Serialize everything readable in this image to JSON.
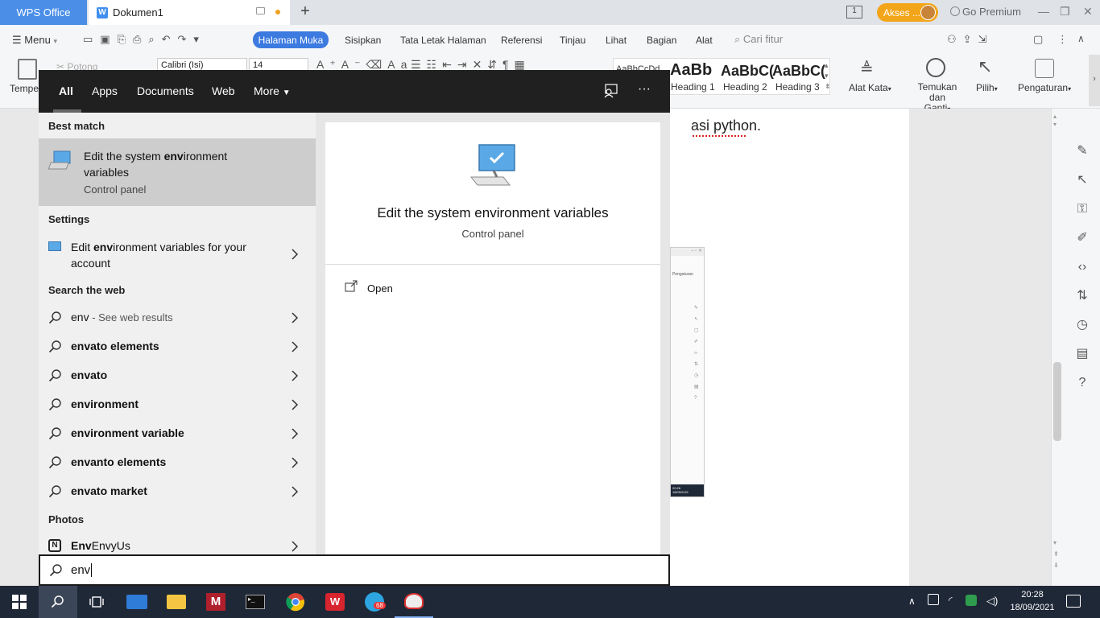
{
  "wps": {
    "app_tab": "WPS Office",
    "doc_tab": "Dokumen1",
    "doc_tab_icon": "W",
    "akses": "Akses ...",
    "go_premium": "Go Premium",
    "menu": "Menu",
    "tabs": [
      "Halaman Muka",
      "Sisipkan",
      "Tata Letak Halaman",
      "Referensi",
      "Tinjau",
      "Lihat",
      "Bagian",
      "Alat"
    ],
    "find_placeholder": "Cari fitur",
    "font_name": "Calibri (Isi)",
    "font_size": "14",
    "potong": "Potong",
    "tempel": "Tempel",
    "styles": [
      "AaBbCcDd",
      "AaBb",
      "AaBbC(",
      "AaBbC("
    ],
    "style_names": [
      "Heading 1",
      "Heading 2",
      "Heading 3"
    ],
    "alat_kata": "Alat Kata",
    "temukan": "Temukan dan",
    "ganti": "Ganti",
    "pilih": "Pilih",
    "pengaturan": "Pengaturan",
    "doc_text": "asi python.",
    "thumb_label": "Pengaturan",
    "thumb_time": "20:26",
    "thumb_date": "18/09/2021"
  },
  "search": {
    "tabs": [
      "All",
      "Apps",
      "Documents",
      "Web",
      "More"
    ],
    "best_match_header": "Best match",
    "best_match_title_prefix": "Edit the system ",
    "best_match_title_bold": "env",
    "best_match_title_line1_suffix": "ironment",
    "best_match_title_line2": "variables",
    "best_match_subtitle": "Control panel",
    "settings_header": "Settings",
    "settings_item_prefix": "Edit ",
    "settings_item_bold": "env",
    "settings_item_suffix": "ironment variables for your",
    "settings_item_line2": "account",
    "web_header": "Search the web",
    "web_first_query": "env",
    "web_first_suffix": " - See web results",
    "web_suggestions": [
      "envato elements",
      "envato",
      "environment",
      "environment variable",
      "envanto elements",
      "envato market"
    ],
    "photos_header": "Photos",
    "photos_item": "EnvyUs",
    "detail_title": "Edit the system environment variables",
    "detail_subtitle": "Control panel",
    "detail_action": "Open",
    "query": "env"
  },
  "taskbar": {
    "time": "20:28",
    "date": "18/09/2021",
    "telegram_badge": "68"
  }
}
